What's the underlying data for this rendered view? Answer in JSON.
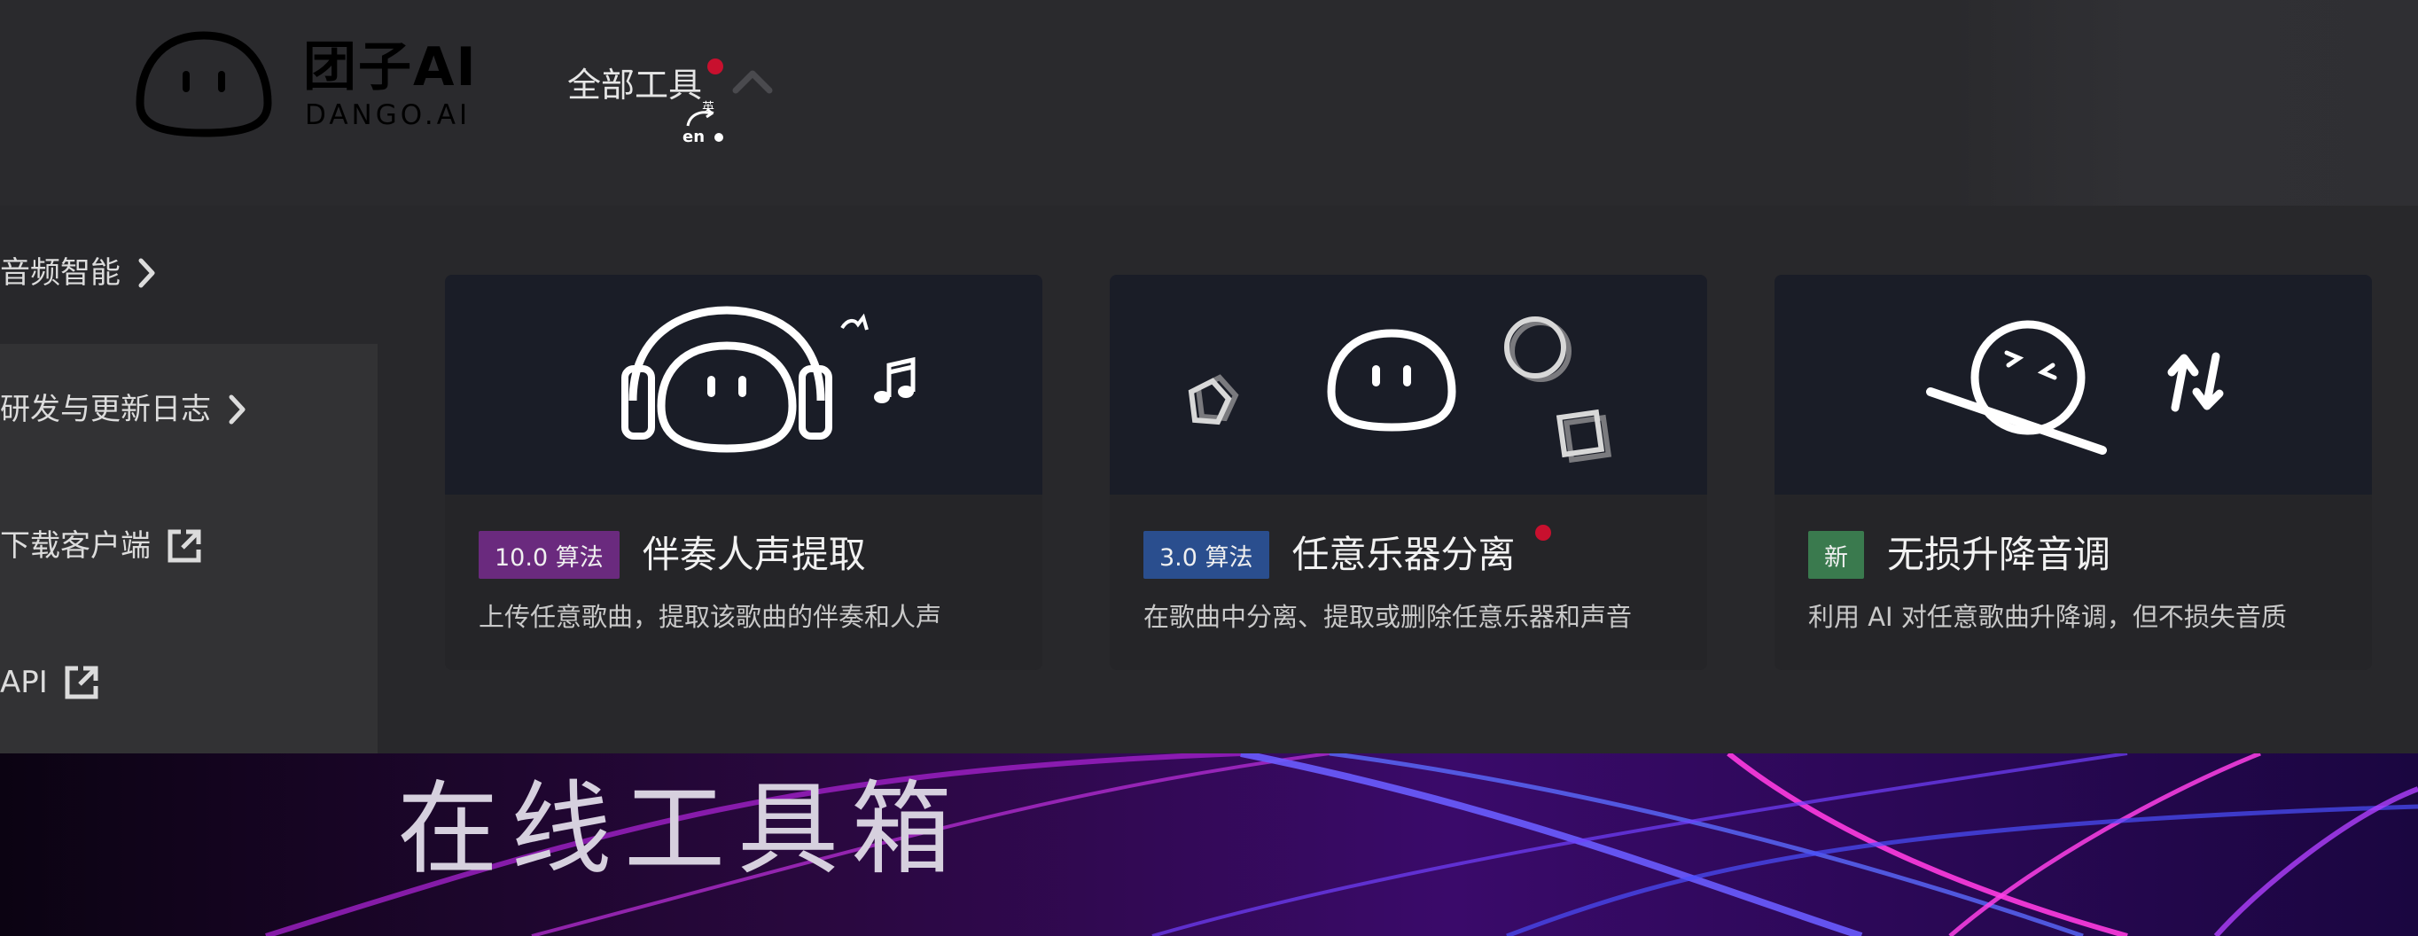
{
  "brand": {
    "name": "团子AI",
    "subtitle": "DANGO.AI"
  },
  "header": {
    "all_tools_label": "全部工具",
    "lang_icon": "translate-icon",
    "lang_from": "en",
    "lang_to": "英"
  },
  "sidebar": {
    "items": [
      {
        "label": "音频智能",
        "icon": "chevron-right-icon"
      },
      {
        "label": "研发与更新日志",
        "icon": "chevron-right-icon"
      },
      {
        "label": "下载客户端",
        "icon": "external-link-icon"
      },
      {
        "label": "API",
        "icon": "external-link-icon"
      }
    ]
  },
  "cards": [
    {
      "badge": "10.0 算法",
      "badge_color": "#6a2a7e",
      "title": "伴奏人声提取",
      "description": "上传任意歌曲，提取该歌曲的伴奏和人声",
      "new_dot": false
    },
    {
      "badge": "3.0 算法",
      "badge_color": "#2a4e8e",
      "title": "任意乐器分离",
      "description": "在歌曲中分离、提取或删除任意乐器和声音",
      "new_dot": true
    },
    {
      "badge": "新",
      "badge_color": "#3a7a4e",
      "title": "无损升降音调",
      "description": "利用 AI 对任意歌曲升降调，但不损失音质",
      "new_dot": false
    }
  ],
  "banner": {
    "title": "在线工具箱"
  },
  "colors": {
    "background": "#28282b",
    "notification_dot": "#c8102e"
  }
}
